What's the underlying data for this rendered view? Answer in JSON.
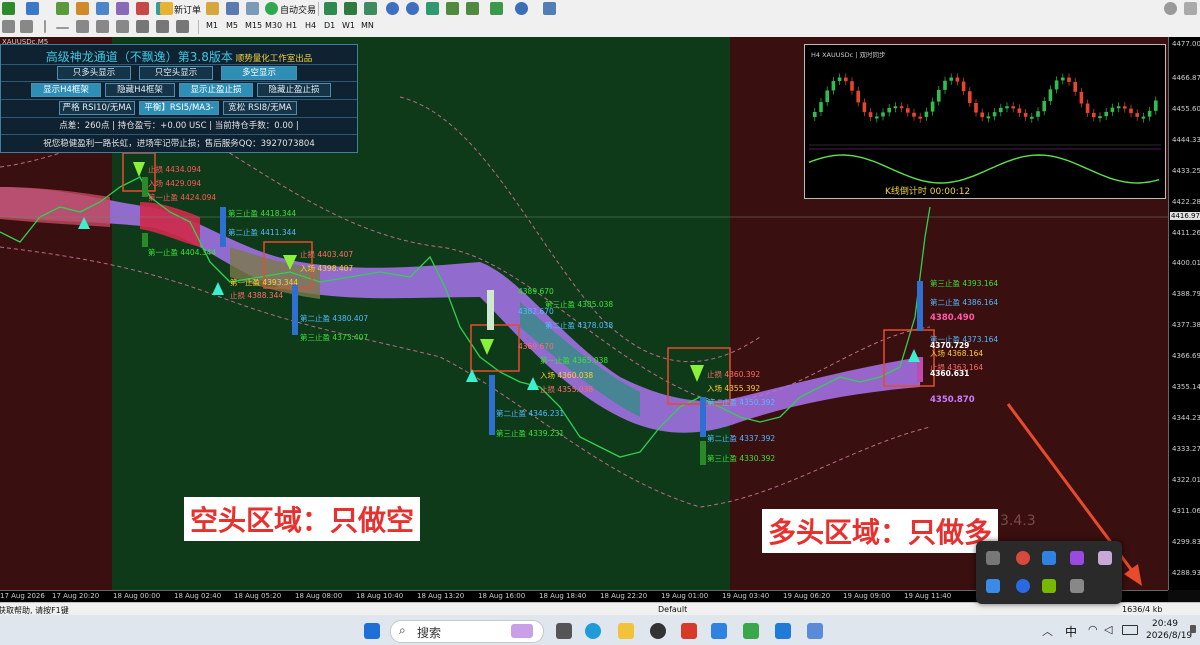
{
  "toolbar": {
    "new_order_label": "新订单",
    "auto_trade_label": "自动交易"
  },
  "timeframes": [
    "M1",
    "M5",
    "M15",
    "M30",
    "H1",
    "H4",
    "D1",
    "W1",
    "MN"
  ],
  "chart": {
    "symbol_label": "XAUUSDc,M5",
    "current_price_tag": "4416.977",
    "zones": {
      "bear_text": "空头区域：只做空",
      "bull_text": "多头区域：只做多"
    },
    "watermark": "3.4.3"
  },
  "panel": {
    "title": "高级神龙通道（不飘逸）第3.8版本",
    "studio": "顺势量化工作室出品",
    "mode_buttons": [
      "只多头显示",
      "只空头显示",
      "多空显示"
    ],
    "toggle_buttons": [
      "显示H4框架",
      "隐藏H4框架",
      "显示止盈止损",
      "隐藏止盈止损"
    ],
    "level_buttons": [
      "严格 RSI10/无MA",
      "平衡】RSI5/MA3-",
      "宽松 RSI8/无MA"
    ],
    "stats": "点差：260点  |  持仓盈亏：+0.00 USC  |  当前持仓手数：0.00  |",
    "blessing": "祝您稳健盈利一路长虹，进场牢记带止损；售后服务QQ：3927073804"
  },
  "minichart": {
    "header": "H4 XAUUSDc  |  双时同步",
    "countdown": "K线倒计时  00:00:12"
  },
  "price_axis": [
    "4477.000",
    "4466.870",
    "4455.600",
    "4444.330",
    "4433.250",
    "4422.280",
    "4411.260",
    "4400.010",
    "4388.790",
    "4377.380",
    "4366.690",
    "4355.140",
    "4344.230",
    "4333.270",
    "4322.010",
    "4311.060",
    "4299.830",
    "4288.930"
  ],
  "time_axis": [
    "17 Aug 2026",
    "17 Aug 20:20",
    "18 Aug 00:00",
    "18 Aug 02:40",
    "18 Aug 05:20",
    "18 Aug 08:00",
    "18 Aug 10:40",
    "18 Aug 13:20",
    "18 Aug 16:00",
    "18 Aug 18:40",
    "18 Aug 22:20",
    "19 Aug 01:00",
    "19 Aug 03:40",
    "19 Aug 06:20",
    "19 Aug 09:00",
    "19 Aug 11:40"
  ],
  "levels": [
    {
      "text": "止损  4434.094",
      "color": "#ff5a5a"
    },
    {
      "text": "入场  4429.094",
      "color": "#ff5a5a"
    },
    {
      "text": "第一止盈  4424.094",
      "color": "#ff5a5a"
    },
    {
      "text": "第三止盈  4418.344",
      "color": "#3be03b"
    },
    {
      "text": "第二止盈  4411.344",
      "color": "#52b8ff"
    },
    {
      "text": "第一止盈  4404.344",
      "color": "#3be03b"
    },
    {
      "text": "止损  4403.407",
      "color": "#ff6b6b"
    },
    {
      "text": "入场  4398.407",
      "color": "#ffcc33"
    },
    {
      "text": "第一止盈  4393.344",
      "color": "#ffcc33"
    },
    {
      "text": "止损  4388.344",
      "color": "#ff6b6b"
    },
    {
      "text": "第二止盈  4380.407",
      "color": "#52b8ff"
    },
    {
      "text": "第三止盈  4373.407",
      "color": "#3be03b"
    },
    {
      "text": "4389.670",
      "color": "#3be03b"
    },
    {
      "text": "4382.670",
      "color": "#52b8ff"
    },
    {
      "text": "第三止盈  4385.038",
      "color": "#3be03b"
    },
    {
      "text": "第二止盈  4378.038",
      "color": "#52b8ff"
    },
    {
      "text": "4369.670",
      "color": "#ff6b6b"
    },
    {
      "text": "第一止盈  4365.038",
      "color": "#3be03b"
    },
    {
      "text": "入场  4360.038",
      "color": "#ffcc33"
    },
    {
      "text": "止损  4355.038",
      "color": "#ff6b6b"
    },
    {
      "text": "第二止盈  4346.231",
      "color": "#52b8ff"
    },
    {
      "text": "第三止盈  4339.231",
      "color": "#3be03b"
    },
    {
      "text": "止损  4360.392",
      "color": "#ff6b6b"
    },
    {
      "text": "入场  4355.392",
      "color": "#ffcc33"
    },
    {
      "text": "第一止盈  4350.392",
      "color": "#52b8ff"
    },
    {
      "text": "第二止盈  4337.392",
      "color": "#52b8ff"
    },
    {
      "text": "第三止盈  4330.392",
      "color": "#3be03b"
    },
    {
      "text": "第三止盈  4393.164",
      "color": "#3be03b"
    },
    {
      "text": "第二止盈  4386.164",
      "color": "#52b8ff"
    },
    {
      "text": "4380.490",
      "color": "#ff5aa8"
    },
    {
      "text": "第一止盈  4373.164",
      "color": "#52b8ff"
    },
    {
      "text": "4370.729",
      "color": "#ffffff"
    },
    {
      "text": "入场  4368.164",
      "color": "#ffcc33"
    },
    {
      "text": "止损  4363.164",
      "color": "#ff6b6b"
    },
    {
      "text": "4360.631",
      "color": "#ffffff"
    },
    {
      "text": "4350.870",
      "color": "#c77dff"
    }
  ],
  "statusbar": {
    "help": "获取帮助, 请按F1键",
    "profile": "Default",
    "traffic": "1636/4 kb"
  },
  "taskbar": {
    "search_placeholder": "搜索",
    "ime": "中",
    "time": "20:49",
    "date": "2026/8/19"
  }
}
